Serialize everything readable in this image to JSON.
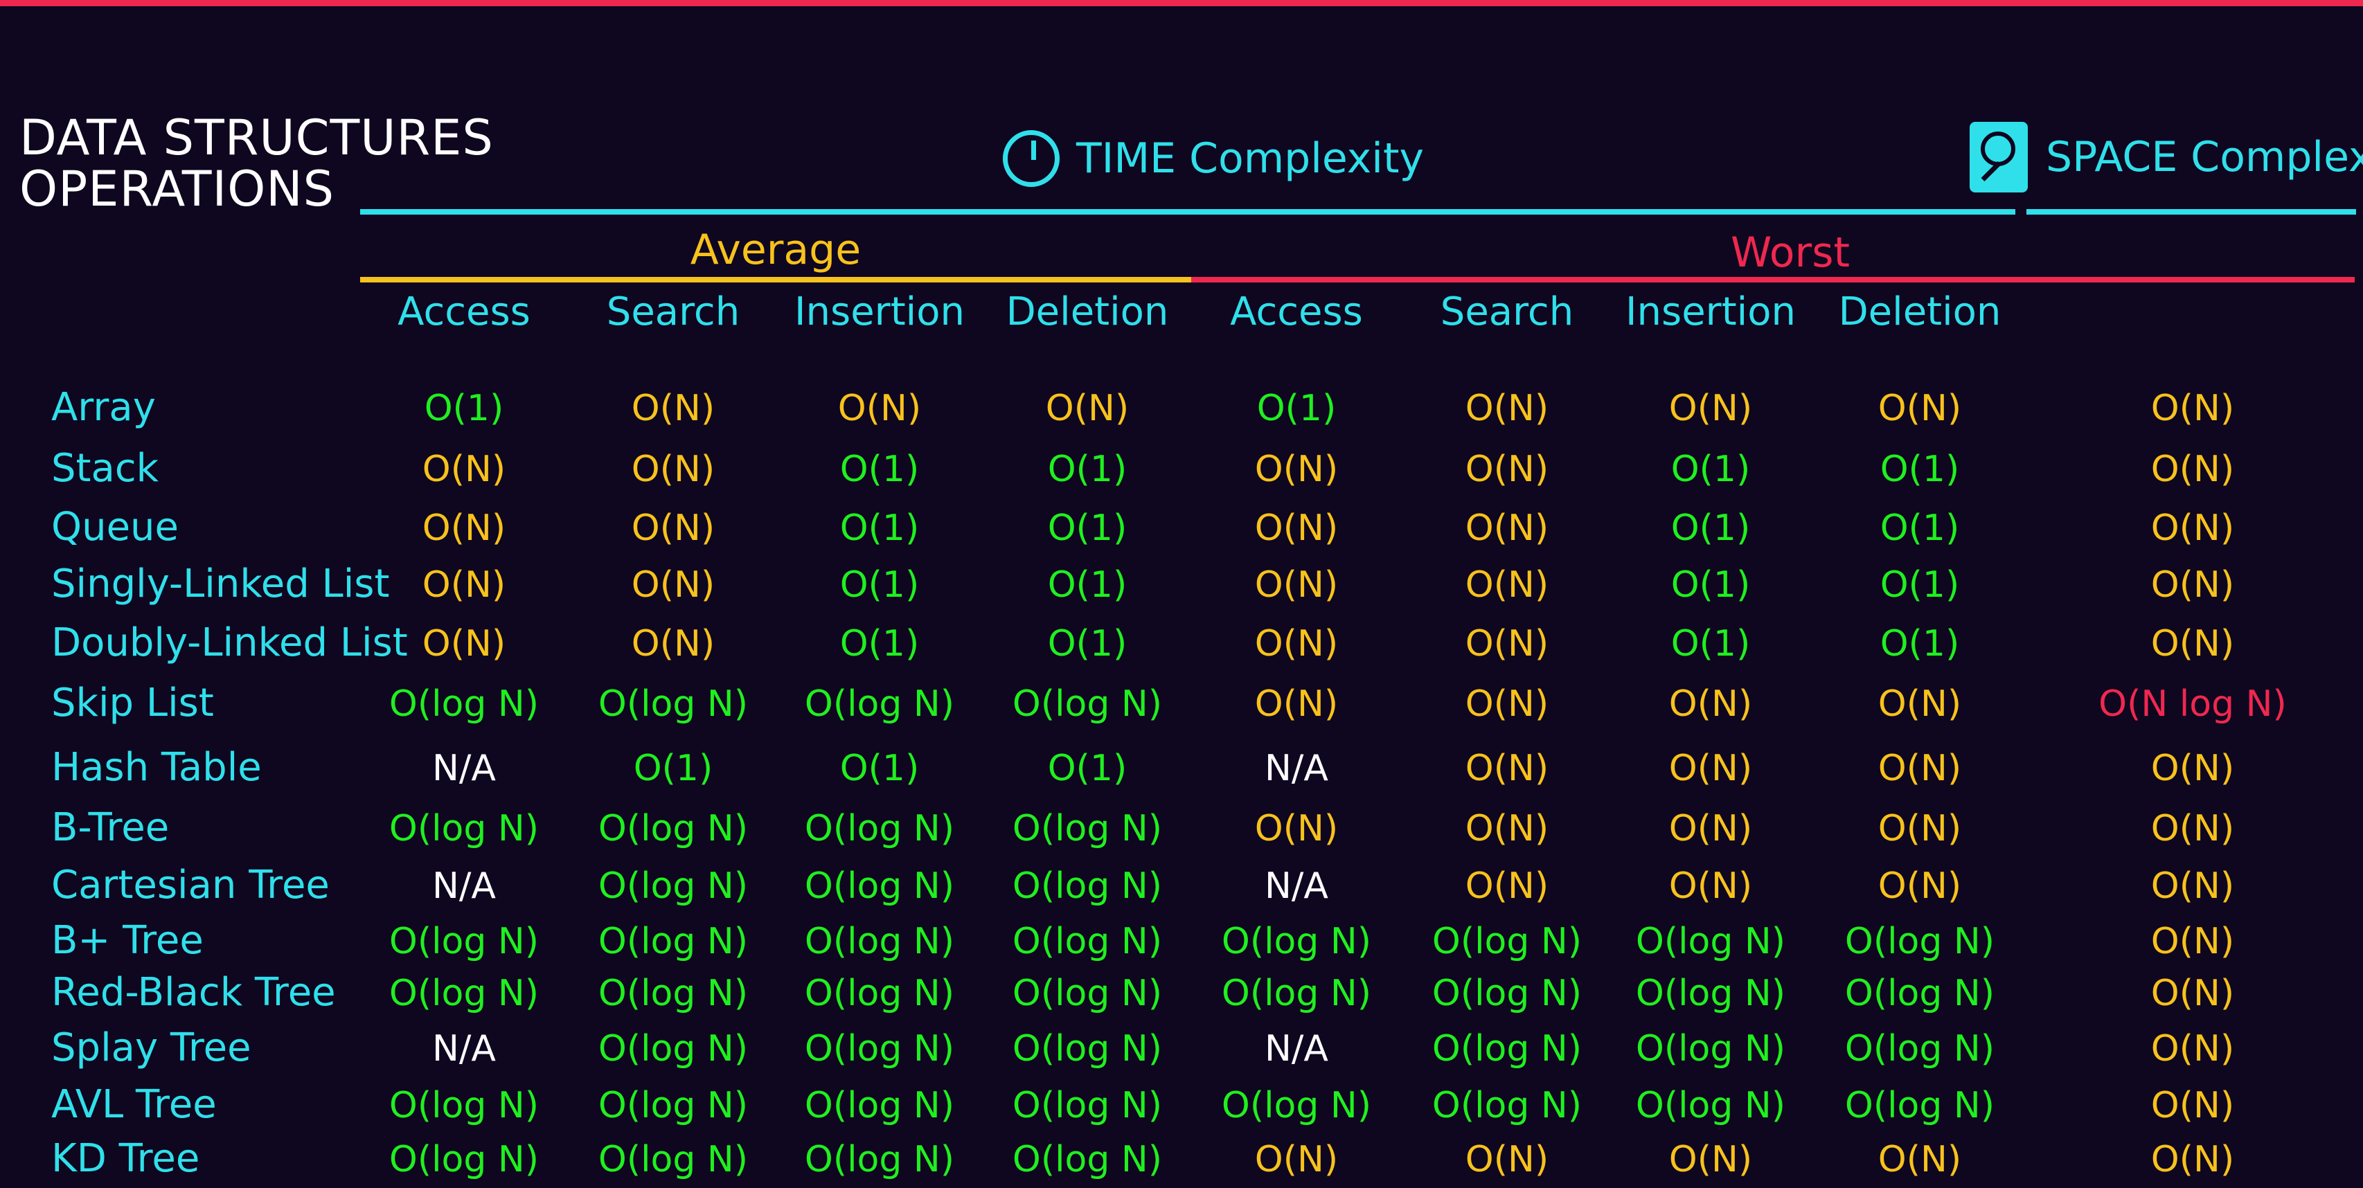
{
  "title": {
    "line1": "DATA STRUCTURES",
    "line2": "OPERATIONS"
  },
  "time_header": "TIME Complexity",
  "space_header": "SPACE Complexity",
  "groups": {
    "average": "Average",
    "worst": "Worst"
  },
  "columns": [
    "Access",
    "Search",
    "Insertion",
    "Deletion",
    "Access",
    "Search",
    "Insertion",
    "Deletion"
  ],
  "colors": {
    "background": "#0f0620",
    "accent_cyan": "#2fe0ea",
    "average_yellow": "#f7c21c",
    "worst_red": "#f0284f",
    "good_green": "#1ff01f"
  },
  "icons": {
    "time": "clock-icon",
    "space": "disk-icon"
  },
  "rows": [
    {
      "name": "Array",
      "cells": [
        {
          "t": "O(1)",
          "c": "g"
        },
        {
          "t": "O(N)",
          "c": "y"
        },
        {
          "t": "O(N)",
          "c": "y"
        },
        {
          "t": "O(N)",
          "c": "y"
        },
        {
          "t": "O(1)",
          "c": "g"
        },
        {
          "t": "O(N)",
          "c": "y"
        },
        {
          "t": "O(N)",
          "c": "y"
        },
        {
          "t": "O(N)",
          "c": "y"
        },
        {
          "t": "O(N)",
          "c": "y"
        }
      ]
    },
    {
      "name": "Stack",
      "cells": [
        {
          "t": "O(N)",
          "c": "y"
        },
        {
          "t": "O(N)",
          "c": "y"
        },
        {
          "t": "O(1)",
          "c": "g"
        },
        {
          "t": "O(1)",
          "c": "g"
        },
        {
          "t": "O(N)",
          "c": "y"
        },
        {
          "t": "O(N)",
          "c": "y"
        },
        {
          "t": "O(1)",
          "c": "g"
        },
        {
          "t": "O(1)",
          "c": "g"
        },
        {
          "t": "O(N)",
          "c": "y"
        }
      ]
    },
    {
      "name": "Queue",
      "cells": [
        {
          "t": "O(N)",
          "c": "y"
        },
        {
          "t": "O(N)",
          "c": "y"
        },
        {
          "t": "O(1)",
          "c": "g"
        },
        {
          "t": "O(1)",
          "c": "g"
        },
        {
          "t": "O(N)",
          "c": "y"
        },
        {
          "t": "O(N)",
          "c": "y"
        },
        {
          "t": "O(1)",
          "c": "g"
        },
        {
          "t": "O(1)",
          "c": "g"
        },
        {
          "t": "O(N)",
          "c": "y"
        }
      ]
    },
    {
      "name": "Singly-Linked List",
      "cells": [
        {
          "t": "O(N)",
          "c": "y"
        },
        {
          "t": "O(N)",
          "c": "y"
        },
        {
          "t": "O(1)",
          "c": "g"
        },
        {
          "t": "O(1)",
          "c": "g"
        },
        {
          "t": "O(N)",
          "c": "y"
        },
        {
          "t": "O(N)",
          "c": "y"
        },
        {
          "t": "O(1)",
          "c": "g"
        },
        {
          "t": "O(1)",
          "c": "g"
        },
        {
          "t": "O(N)",
          "c": "y"
        }
      ]
    },
    {
      "name": "Doubly-Linked List",
      "cells": [
        {
          "t": "O(N)",
          "c": "y"
        },
        {
          "t": "O(N)",
          "c": "y"
        },
        {
          "t": "O(1)",
          "c": "g"
        },
        {
          "t": "O(1)",
          "c": "g"
        },
        {
          "t": "O(N)",
          "c": "y"
        },
        {
          "t": "O(N)",
          "c": "y"
        },
        {
          "t": "O(1)",
          "c": "g"
        },
        {
          "t": "O(1)",
          "c": "g"
        },
        {
          "t": "O(N)",
          "c": "y"
        }
      ]
    },
    {
      "name": "Skip List",
      "cells": [
        {
          "t": "O(log N)",
          "c": "g"
        },
        {
          "t": "O(log N)",
          "c": "g"
        },
        {
          "t": "O(log N)",
          "c": "g"
        },
        {
          "t": "O(log N)",
          "c": "g"
        },
        {
          "t": "O(N)",
          "c": "y"
        },
        {
          "t": "O(N)",
          "c": "y"
        },
        {
          "t": "O(N)",
          "c": "y"
        },
        {
          "t": "O(N)",
          "c": "y"
        },
        {
          "t": "O(N log N)",
          "c": "r"
        }
      ]
    },
    {
      "name": "Hash Table",
      "cells": [
        {
          "t": "N/A",
          "c": "w"
        },
        {
          "t": "O(1)",
          "c": "g"
        },
        {
          "t": "O(1)",
          "c": "g"
        },
        {
          "t": "O(1)",
          "c": "g"
        },
        {
          "t": "N/A",
          "c": "w"
        },
        {
          "t": "O(N)",
          "c": "y"
        },
        {
          "t": "O(N)",
          "c": "y"
        },
        {
          "t": "O(N)",
          "c": "y"
        },
        {
          "t": "O(N)",
          "c": "y"
        }
      ]
    },
    {
      "name": "B-Tree",
      "cells": [
        {
          "t": "O(log N)",
          "c": "g"
        },
        {
          "t": "O(log N)",
          "c": "g"
        },
        {
          "t": "O(log N)",
          "c": "g"
        },
        {
          "t": "O(log N)",
          "c": "g"
        },
        {
          "t": "O(N)",
          "c": "y"
        },
        {
          "t": "O(N)",
          "c": "y"
        },
        {
          "t": "O(N)",
          "c": "y"
        },
        {
          "t": "O(N)",
          "c": "y"
        },
        {
          "t": "O(N)",
          "c": "y"
        }
      ]
    },
    {
      "name": "Cartesian Tree",
      "cells": [
        {
          "t": "N/A",
          "c": "w"
        },
        {
          "t": "O(log N)",
          "c": "g"
        },
        {
          "t": "O(log N)",
          "c": "g"
        },
        {
          "t": "O(log N)",
          "c": "g"
        },
        {
          "t": "N/A",
          "c": "w"
        },
        {
          "t": "O(N)",
          "c": "y"
        },
        {
          "t": "O(N)",
          "c": "y"
        },
        {
          "t": "O(N)",
          "c": "y"
        },
        {
          "t": "O(N)",
          "c": "y"
        }
      ]
    },
    {
      "name": "B+ Tree",
      "cells": [
        {
          "t": "O(log N)",
          "c": "g"
        },
        {
          "t": "O(log N)",
          "c": "g"
        },
        {
          "t": "O(log N)",
          "c": "g"
        },
        {
          "t": "O(log N)",
          "c": "g"
        },
        {
          "t": "O(log N)",
          "c": "g"
        },
        {
          "t": "O(log N)",
          "c": "g"
        },
        {
          "t": "O(log N)",
          "c": "g"
        },
        {
          "t": "O(log N)",
          "c": "g"
        },
        {
          "t": "O(N)",
          "c": "y"
        }
      ]
    },
    {
      "name": "Red-Black Tree",
      "cells": [
        {
          "t": "O(log N)",
          "c": "g"
        },
        {
          "t": "O(log N)",
          "c": "g"
        },
        {
          "t": "O(log N)",
          "c": "g"
        },
        {
          "t": "O(log N)",
          "c": "g"
        },
        {
          "t": "O(log N)",
          "c": "g"
        },
        {
          "t": "O(log N)",
          "c": "g"
        },
        {
          "t": "O(log N)",
          "c": "g"
        },
        {
          "t": "O(log N)",
          "c": "g"
        },
        {
          "t": "O(N)",
          "c": "y"
        }
      ]
    },
    {
      "name": "Splay Tree",
      "cells": [
        {
          "t": "N/A",
          "c": "w"
        },
        {
          "t": "O(log N)",
          "c": "g"
        },
        {
          "t": "O(log N)",
          "c": "g"
        },
        {
          "t": "O(log N)",
          "c": "g"
        },
        {
          "t": "N/A",
          "c": "w"
        },
        {
          "t": "O(log N)",
          "c": "g"
        },
        {
          "t": "O(log N)",
          "c": "g"
        },
        {
          "t": "O(log N)",
          "c": "g"
        },
        {
          "t": "O(N)",
          "c": "y"
        }
      ]
    },
    {
      "name": "AVL Tree",
      "cells": [
        {
          "t": "O(log N)",
          "c": "g"
        },
        {
          "t": "O(log N)",
          "c": "g"
        },
        {
          "t": "O(log N)",
          "c": "g"
        },
        {
          "t": "O(log N)",
          "c": "g"
        },
        {
          "t": "O(log N)",
          "c": "g"
        },
        {
          "t": "O(log N)",
          "c": "g"
        },
        {
          "t": "O(log N)",
          "c": "g"
        },
        {
          "t": "O(log N)",
          "c": "g"
        },
        {
          "t": "O(N)",
          "c": "y"
        }
      ]
    },
    {
      "name": "KD Tree",
      "cells": [
        {
          "t": "O(log N)",
          "c": "g"
        },
        {
          "t": "O(log N)",
          "c": "g"
        },
        {
          "t": "O(log N)",
          "c": "g"
        },
        {
          "t": "O(log N)",
          "c": "g"
        },
        {
          "t": "O(N)",
          "c": "y"
        },
        {
          "t": "O(N)",
          "c": "y"
        },
        {
          "t": "O(N)",
          "c": "y"
        },
        {
          "t": "O(N)",
          "c": "y"
        },
        {
          "t": "O(N)",
          "c": "y"
        }
      ]
    }
  ]
}
